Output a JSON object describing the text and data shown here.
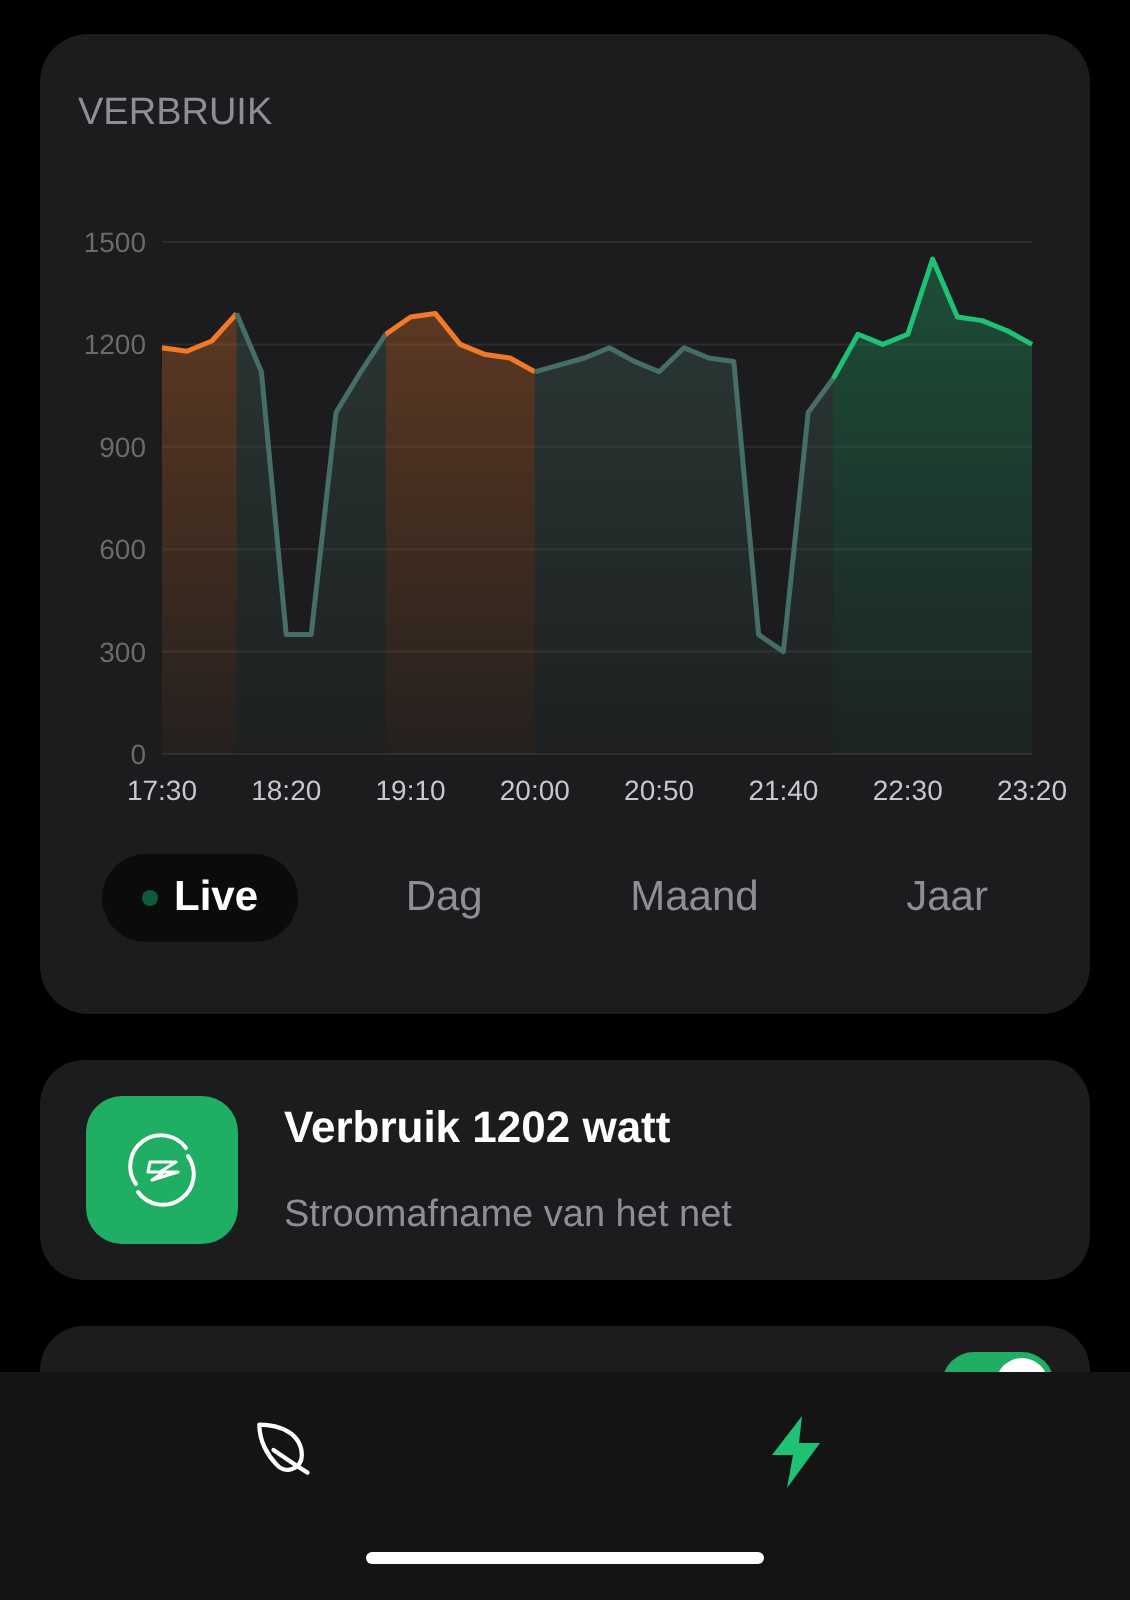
{
  "usage_card": {
    "title": "VERBRUIK",
    "chart_data": {
      "type": "area",
      "categories": [
        "17:30",
        null,
        null,
        null,
        null,
        "18:20",
        null,
        null,
        null,
        null,
        "19:10",
        null,
        null,
        null,
        null,
        "20:00",
        null,
        null,
        null,
        null,
        "20:50",
        null,
        null,
        null,
        null,
        "21:40",
        null,
        null,
        null,
        null,
        "22:30",
        null,
        null,
        null,
        null,
        "23:20"
      ],
      "grid": true,
      "series": [
        {
          "color": "#f07a2a",
          "values": [
            1190,
            1180,
            1210,
            1290,
            null,
            null,
            null,
            null,
            null,
            null,
            null,
            null,
            null,
            null,
            null,
            null,
            null,
            null,
            null,
            null,
            null,
            null,
            null,
            null,
            null,
            null,
            null,
            null,
            null,
            null,
            null,
            null,
            null,
            null,
            null,
            null
          ]
        },
        {
          "color": "#456f64",
          "values": [
            null,
            null,
            null,
            1290,
            1120,
            350,
            350,
            1000,
            1120,
            1230,
            null,
            null,
            null,
            null,
            null,
            null,
            null,
            null,
            null,
            null,
            null,
            null,
            null,
            null,
            null,
            null,
            null,
            null,
            null,
            null,
            null,
            null,
            null,
            null,
            null,
            null
          ]
        },
        {
          "color": "#f07a2a",
          "values": [
            null,
            null,
            null,
            null,
            null,
            null,
            null,
            null,
            null,
            1230,
            1280,
            1290,
            1200,
            1170,
            1160,
            1120,
            null,
            null,
            null,
            null,
            null,
            null,
            null,
            null,
            null,
            null,
            null,
            null,
            null,
            null,
            null,
            null,
            null,
            null,
            null,
            null
          ]
        },
        {
          "color": "#456f64",
          "values": [
            null,
            null,
            null,
            null,
            null,
            null,
            null,
            null,
            null,
            null,
            null,
            null,
            null,
            null,
            null,
            1120,
            1140,
            1160,
            1190,
            1150,
            1120,
            1190,
            1160,
            1150,
            350,
            300,
            1000,
            1100,
            null,
            null,
            null,
            null,
            null,
            null,
            null,
            null
          ]
        },
        {
          "color": "#1fc275",
          "values": [
            null,
            null,
            null,
            null,
            null,
            null,
            null,
            null,
            null,
            null,
            null,
            null,
            null,
            null,
            null,
            null,
            null,
            null,
            null,
            null,
            null,
            null,
            null,
            null,
            null,
            null,
            null,
            1100,
            1230,
            1200,
            1230,
            1450,
            1280,
            1270,
            1240,
            1200
          ]
        }
      ],
      "ylim": [
        0,
        1500
      ],
      "yticks": [
        0,
        300,
        600,
        900,
        1200,
        1500
      ]
    },
    "periods": [
      {
        "label": "Live",
        "selected": true
      },
      {
        "label": "Dag",
        "selected": false
      },
      {
        "label": "Maand",
        "selected": false
      },
      {
        "label": "Jaar",
        "selected": false
      }
    ]
  },
  "status_card": {
    "title": "Verbruik 1202 watt",
    "subtitle": "Stroomafname van het net"
  },
  "setting_card": {
    "on": true
  },
  "bottom_nav": [
    {
      "kind": "leaf",
      "selected": false
    },
    {
      "kind": "bolt",
      "selected": true
    }
  ]
}
